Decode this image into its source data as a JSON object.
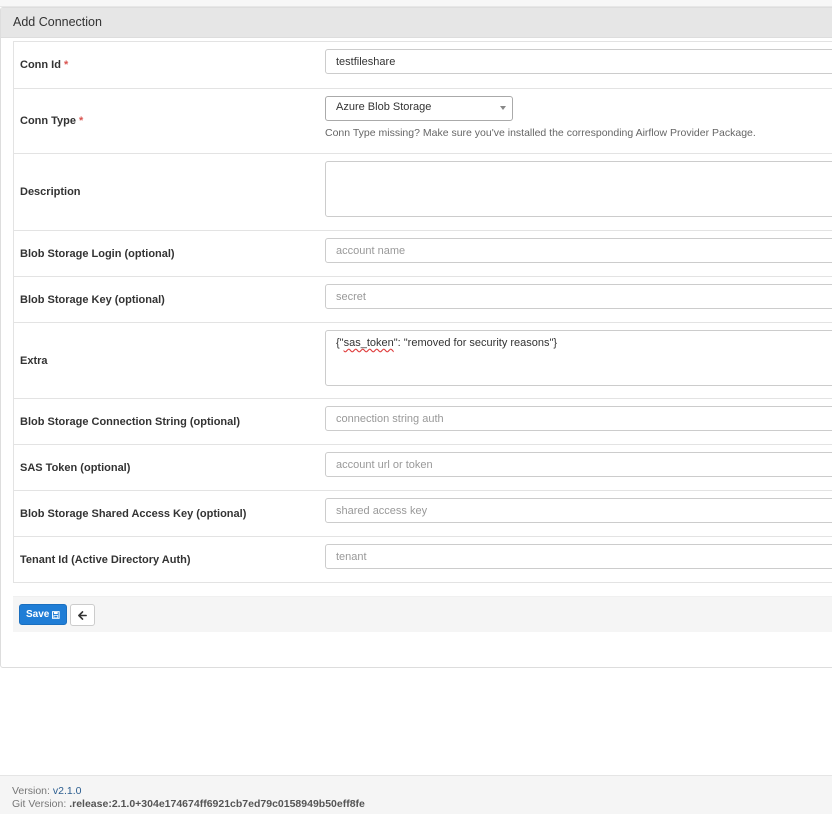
{
  "panel": {
    "title": "Add Connection"
  },
  "fields": {
    "conn_id": {
      "label": "Conn Id",
      "required_mark": "*",
      "value": "testfileshare"
    },
    "conn_type": {
      "label": "Conn Type",
      "required_mark": "*",
      "selected": "Azure Blob Storage",
      "help": "Conn Type missing? Make sure you've installed the corresponding Airflow Provider Package."
    },
    "description": {
      "label": "Description",
      "value": ""
    },
    "login": {
      "label": "Blob Storage Login (optional)",
      "placeholder": "account name"
    },
    "key": {
      "label": "Blob Storage Key (optional)",
      "placeholder": "secret"
    },
    "extra": {
      "label": "Extra",
      "value_prefix": "{\"",
      "value_key": "sas_token",
      "value_suffix": "\": \"removed for security reasons\"}"
    },
    "conn_string": {
      "label": "Blob Storage Connection String (optional)",
      "placeholder": "connection string auth"
    },
    "sas_token": {
      "label": "SAS Token (optional)",
      "placeholder": "account url or token"
    },
    "shared_key": {
      "label": "Blob Storage Shared Access Key (optional)",
      "placeholder": "shared access key"
    },
    "tenant": {
      "label": "Tenant Id (Active Directory Auth)",
      "placeholder": "tenant"
    }
  },
  "actions": {
    "save_label": "Save",
    "save_icon": "floppy-disk-icon",
    "back_icon": "arrow-left-icon"
  },
  "footer": {
    "version_label": "Version:",
    "version": "v2.1.0",
    "git_label": "Git Version:",
    "git_version": ".release:2.1.0+304e174674ff6921cb7ed79c0158949b50eff8fe"
  }
}
